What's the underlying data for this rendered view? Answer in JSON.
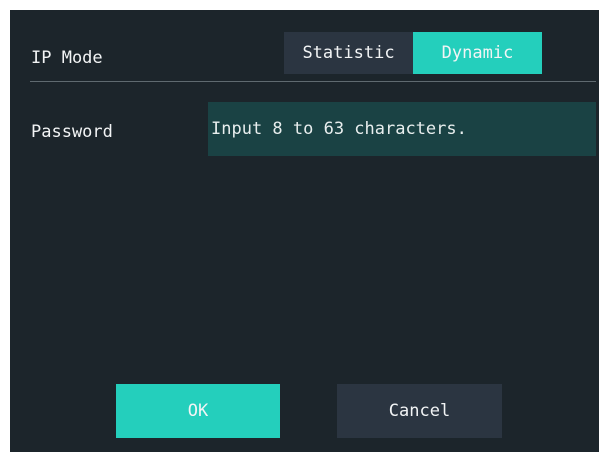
{
  "ip_mode": {
    "label": "IP Mode",
    "options": [
      "Statistic",
      "Dynamic"
    ],
    "selected": "Dynamic"
  },
  "password": {
    "label": "Password",
    "value": "",
    "placeholder": "Input 8 to 63 characters."
  },
  "buttons": {
    "ok_label": "OK",
    "cancel_label": "Cancel"
  },
  "colors": {
    "background": "#1c252b",
    "accent": "#24cfbc",
    "segment_inactive": "#2b3541",
    "input_background": "#1a4244"
  }
}
